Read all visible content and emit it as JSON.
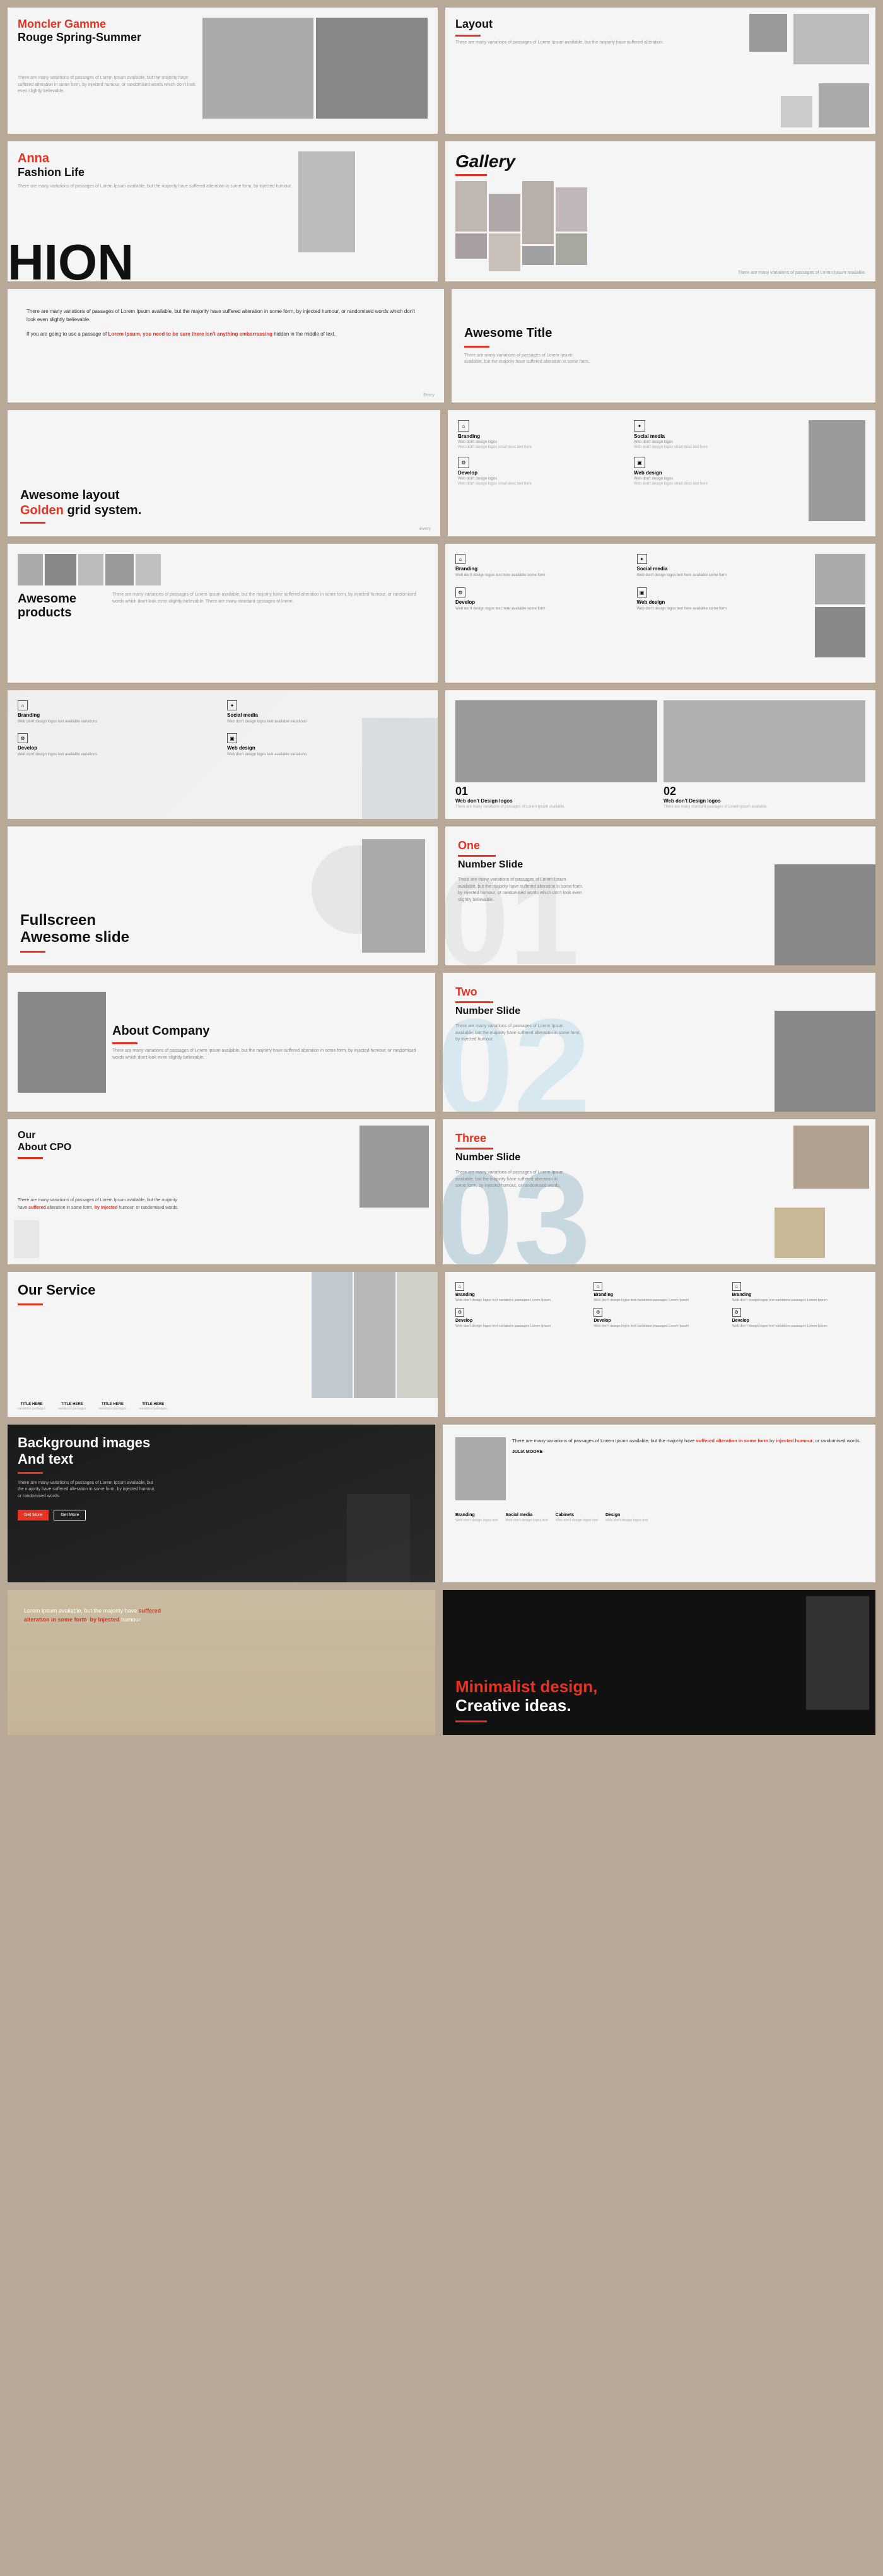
{
  "slides": {
    "row1": {
      "left": {
        "title_red": "Moncler Gamme",
        "title_black": "Rouge Spring-Summer",
        "small_text": "There are many variations of passages of Lorem Ipsum available, but the majority have suffered alteration in some form, by injected humour, or randomised words which don't look even slightly believable."
      },
      "right": {
        "title": "Layout",
        "small_text": "There are many variations of passages of Lorem Ipsum available, but the majority have suffered alteration."
      }
    },
    "row2": {
      "left": {
        "name_red": "Anna",
        "title": "Fashion Life",
        "big_letter": "HION",
        "small_text": "There are many variations of passages of Lorem Ipsum available, but the majority have suffered alteration in some form, by injected humour."
      },
      "right": {
        "gallery_title": "Gallery",
        "small_text": "There are many variations of passages of Lorem Ipsum available."
      }
    },
    "row3": {
      "left": {
        "main_text": "There are many variations of passages of Lorem Ipsum available, but the majority have suffered alteration in some form, by injected humour, or randomised words which don't look even slightly believable.",
        "highlight_text": "If you are going to use a passage of Lorem Ipsum, you need to be sure there isn't anything embarrassing hidden in the middle of text.",
        "footer": "Every"
      },
      "right": {
        "title": "Awesome Title",
        "small_text": ""
      }
    },
    "row4": {
      "left": {
        "title1": "Awesome layout",
        "title2_red": "Golden",
        "title3": "grid system.",
        "footer": "Every"
      },
      "right": {
        "title": "Branding Social Develop design",
        "branding_label": "Branding",
        "social_label": "Social media",
        "develop_label": "Develop",
        "web_label": "Web design",
        "service_desc": "Web don't design logos"
      }
    },
    "row5": {
      "left": {
        "title": "Awesome products",
        "small_text": "There are many variations of passages of Lorem Ipsum available, but the majority have suffered alteration in some form, by injected humour, or randomised words which don't look even slightly believable. There are many standard passages of lorem."
      },
      "right": {
        "branding_label": "Branding",
        "social_label": "Social media",
        "develop_label": "Develop",
        "web_label": "Web design",
        "desc": "Web don't design logos"
      }
    },
    "row6": {
      "left": {
        "branding_label": "Branding",
        "social_label": "Social media",
        "develop_label": "Develop",
        "web_label": "Web design",
        "desc": "Web don't design logos"
      },
      "right": {
        "num1": "01",
        "num2": "02",
        "label1": "Web don't Design logos",
        "label2": "Web don't Design logos",
        "small1": "There are many variations of passages of Lorem Ipsum available.",
        "small2": "There are many standard passages of Lorem ipsum available."
      }
    },
    "row7": {
      "left": {
        "title1": "Fullscreen",
        "title2": "Awesome slide"
      },
      "right": {
        "label_red": "One",
        "title": "Number Slide",
        "small_text": "There are many variations of passages of Lorem Ipsum available, but the majority have suffered alteration in some form, by injected humour, or randomised words which don't look even slightly believable.",
        "number_bg": "01"
      }
    },
    "row8": {
      "left": {
        "title": "About Company",
        "small_text": "There are many variations of passages of Lorem Ipsum available, but the majority have suffered alteration in some form, by injected humour, or randomised words which don't look even slightly believable."
      },
      "right": {
        "label_red": "Two",
        "title": "Number Slide",
        "small_text": "There are many variations of passages of Lorem Ipsum available, but the majority have suffered alteration in some form, by injected humour.",
        "number_bg": "02"
      }
    },
    "row9": {
      "left": {
        "title1": "Our",
        "title2": "About CPO",
        "body_text": "There are many variations of passages of Lorem Ipsum available, but the majority have suffered alteration in some form, by injected humour, or randomised words.",
        "highlight": "suffered",
        "highlight2": "by Injected"
      },
      "right": {
        "label_red": "Three",
        "title": "Number Slide",
        "small_text": "There are many variations of passages of Lorem Ipsum available, but the majority have suffered alteration in some form, by injected humour, or randomised words.",
        "number_bg": "03"
      }
    },
    "row10": {
      "left": {
        "title": "Our Service",
        "title_items": [
          "TITLE HERE",
          "TITLE HERE",
          "TITLE HERE",
          "TITLE HERE"
        ]
      },
      "right": {
        "branding_labels": [
          "Branding",
          "Branding",
          "Branding"
        ],
        "develop_labels": [
          "Develop",
          "Develop",
          "Develop"
        ],
        "desc": "Web don't design logos"
      }
    },
    "row11": {
      "left": {
        "title1": "Background images",
        "title2": "And text",
        "body_text": "There are many variations of passages of Lorem Ipsum available, but the majority have suffered alteration in some form, by injected humour, or randomised words.",
        "btn1": "Get More",
        "btn2": "Get More"
      },
      "right": {
        "body_text": "There are many variations of passages of Lorem Ipsum available, but the majority have suffered alteration in some form, by injected humour, or randomised words.",
        "highlight": "suffered alteration in some form",
        "highlight2": "by injected humour",
        "author": "JULIA MOORE",
        "branding": "Branding",
        "social": "Social media",
        "cabinets": "Cabinets",
        "design": "Design"
      }
    },
    "row12": {
      "left": {
        "body_text": "Lorem Ipsum available, but the majority have suffered alteration in some form, by Injected humour",
        "highlight": "suffered alteration in some form",
        "highlight2": "by Injected"
      },
      "right": {
        "title_red": "Minimalist design,",
        "title_black": "Creative ideas."
      }
    }
  }
}
